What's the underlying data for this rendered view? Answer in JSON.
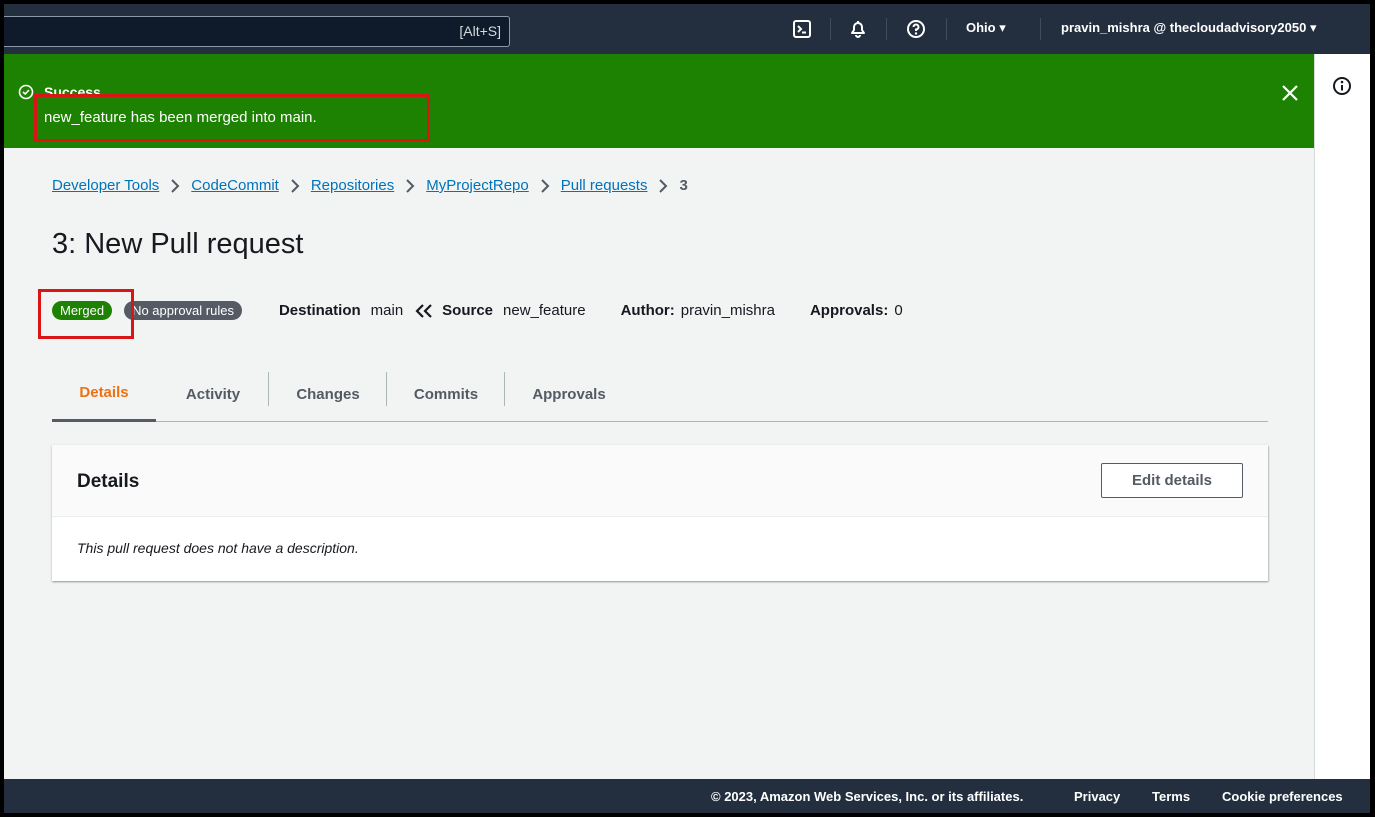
{
  "topnav": {
    "search_shortcut": "[Alt+S]",
    "region": "Ohio",
    "account": "pravin_mishra @ thecloudadvisory2050"
  },
  "flash": {
    "title": "Success",
    "message": "new_feature has been merged into main."
  },
  "breadcrumb": {
    "items": [
      "Developer Tools",
      "CodeCommit",
      "Repositories",
      "MyProjectRepo",
      "Pull requests"
    ],
    "current": "3"
  },
  "page": {
    "title": "3: New Pull request"
  },
  "meta": {
    "status_badge": "Merged",
    "rules_badge": "No approval rules",
    "destination_label": "Destination",
    "destination_value": "main",
    "source_label": "Source",
    "source_value": "new_feature",
    "author_label": "Author:",
    "author_value": "pravin_mishra",
    "approvals_label": "Approvals:",
    "approvals_value": "0"
  },
  "tabs": [
    "Details",
    "Activity",
    "Changes",
    "Commits",
    "Approvals"
  ],
  "details_panel": {
    "title": "Details",
    "edit_button": "Edit details",
    "description": "This pull request does not have a description."
  },
  "footer": {
    "copyright": "© 2023, Amazon Web Services, Inc. or its affiliates.",
    "privacy": "Privacy",
    "terms": "Terms",
    "cookies": "Cookie preferences"
  },
  "colors": {
    "nav_bg": "#232f3e",
    "success_green": "#1d8102",
    "link_blue": "#0073bb",
    "tab_active": "#ec7211",
    "highlight_red": "#d91515"
  }
}
